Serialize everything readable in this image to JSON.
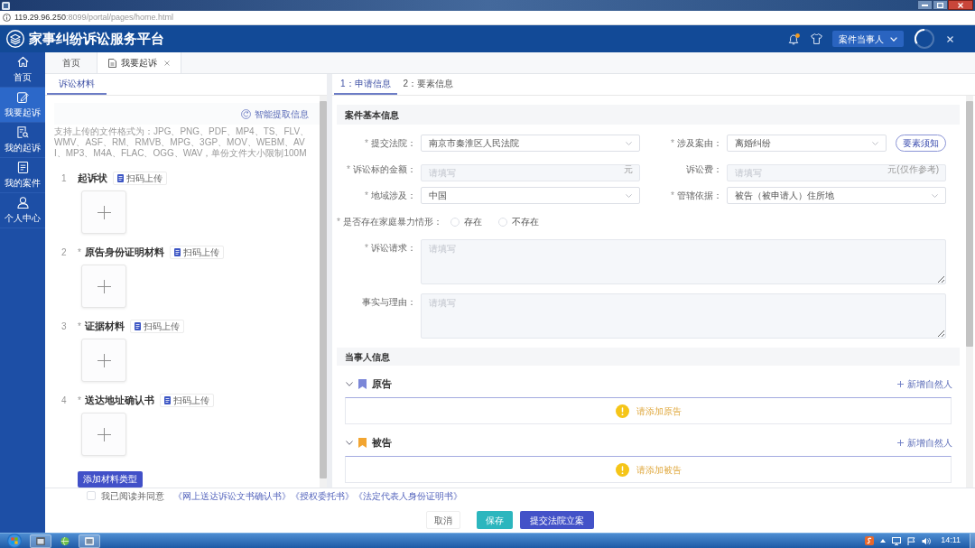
{
  "address_bar": {
    "host": "119.29.96.250",
    "path": ":8099/portal/pages/home.html"
  },
  "header": {
    "title": "家事纠纷诉讼服务平台",
    "role_select": "案件当事人"
  },
  "sidebar": {
    "items": [
      {
        "label": "首页",
        "selected": false
      },
      {
        "label": "我要起诉",
        "selected": true
      },
      {
        "label": "我的起诉",
        "selected": false
      },
      {
        "label": "我的案件",
        "selected": false
      },
      {
        "label": "个人中心",
        "selected": false
      }
    ]
  },
  "page_tabs": [
    {
      "label": "首页",
      "selected": false,
      "closable": false
    },
    {
      "label": "我要起诉",
      "selected": true,
      "closable": true
    }
  ],
  "materials_panel": {
    "tab": "诉讼材料",
    "smart_extract": "智能提取信息",
    "note": "支持上传的文件格式为：JPG、PNG、PDF、MP4、TS、FLV、WMV、ASF、RM、RMVB、MPG、3GP、MOV、WEBM、AVI、MP3、M4A、FLAC、OGG、WAV，单份文件大小限制100M",
    "items": [
      {
        "number": "1",
        "title": "起诉状",
        "scan": "扫码上传"
      },
      {
        "number": "2",
        "required_mark": "*",
        "title": "原告身份证明材料",
        "scan": "扫码上传"
      },
      {
        "number": "3",
        "required_mark": "*",
        "title": "证据材料",
        "scan": "扫码上传"
      },
      {
        "number": "4",
        "required_mark": "*",
        "title": "送达地址确认书",
        "scan": "扫码上传"
      }
    ],
    "add_button": "添加材料类型"
  },
  "form_panel": {
    "tabs": [
      {
        "label": "1：申请信息",
        "selected": true
      },
      {
        "label": "2：要素信息",
        "selected": false
      }
    ],
    "case_section": {
      "title": "案件基本信息",
      "fields": [
        {
          "kind": "select",
          "required_mark": "*",
          "label": "提交法院：",
          "value": "南京市秦淮区人民法院"
        },
        {
          "kind": "select",
          "required_mark": "*",
          "label": "涉及案由：",
          "value": "离婚纠纷",
          "button": "要素须知"
        },
        {
          "kind": "input",
          "required_mark": "*",
          "label": "诉讼标的金额：",
          "placeholder": "请填写",
          "suffix": "元"
        },
        {
          "kind": "input",
          "label": "诉讼费：",
          "placeholder": "请填写",
          "suffix": "元(仅作参考)"
        },
        {
          "kind": "select",
          "required_mark": "*",
          "label": "地域涉及：",
          "value": "中国"
        },
        {
          "kind": "select",
          "required_mark": "*",
          "label": "管辖依据：",
          "value": "被告（被申请人）住所地"
        },
        {
          "kind": "radio",
          "required_mark": "*",
          "label": "是否存在家庭暴力情形：",
          "options": [
            {
              "label": "存在",
              "selected": false
            },
            {
              "label": "不存在",
              "selected": false
            }
          ]
        },
        {
          "kind": "textarea",
          "required_mark": "*",
          "label": "诉讼请求：",
          "placeholder": "请填写"
        },
        {
          "kind": "textarea",
          "label": "事实与理由：",
          "placeholder": "请填写"
        }
      ]
    },
    "party_section": {
      "title": "当事人信息",
      "groups": [
        {
          "label": "原告",
          "color": "#7b87d8",
          "expanded": true,
          "add_link": "新增自然人",
          "empty_text": "请添加原告"
        },
        {
          "label": "被告",
          "color": "#f2a531",
          "expanded": true,
          "add_link": "新增自然人",
          "empty_text": "请添加被告"
        }
      ]
    }
  },
  "footer": {
    "agree": {
      "checked": false,
      "text": "我已阅读并同意",
      "links": [
        "《网上送达诉讼文书确认书》",
        "《授权委托书》",
        "《法定代表人身份证明书》"
      ]
    },
    "buttons": [
      {
        "label": "取消",
        "kind": "default"
      },
      {
        "label": "保存",
        "kind": "save"
      },
      {
        "label": "提交法院立案",
        "kind": "primary"
      }
    ]
  },
  "taskbar": {
    "clock": "14:11"
  }
}
